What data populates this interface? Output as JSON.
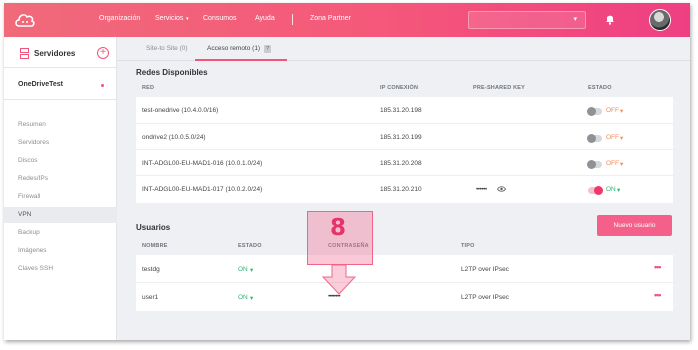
{
  "nav": {
    "items": [
      "Organización",
      "Servicios",
      "Consumos",
      "Ayuda",
      "Zona Partner"
    ],
    "services_caret": "▾",
    "select_caret": "▾"
  },
  "sidebar": {
    "title": "Servidores",
    "add": "+",
    "account": "OneDriveTest",
    "items": [
      "Resumen",
      "Servidores",
      "Discos",
      "Redes/IPs",
      "Firewall",
      "VPN",
      "Backup",
      "Imágenes",
      "Claves SSH"
    ],
    "active_item": "VPN"
  },
  "tabs": {
    "site_to_site": "Site-to Site (0)",
    "remote_access": "Acceso remoto (1)",
    "remote_badge": "?"
  },
  "networks": {
    "title": "Redes Disponibles",
    "headers": {
      "red": "RED",
      "ip": "IP CONEXIÓN",
      "psk": "PRE-SHARED KEY",
      "estado": "ESTADO"
    },
    "rows": [
      {
        "name": "test-onedrive (10.4.0.0/16)",
        "ip": "185.31.20.198",
        "psk": "",
        "status": "OFF",
        "on": false
      },
      {
        "name": "ondrive2 (10.0.5.0/24)",
        "ip": "185.31.20.199",
        "psk": "",
        "status": "OFF",
        "on": false
      },
      {
        "name": "INT-ADGL00-EU-MAD1-016 (10.0.1.0/24)",
        "ip": "185.31.20.208",
        "psk": "",
        "status": "OFF",
        "on": false
      },
      {
        "name": "INT-ADGL00-EU-MAD1-017 (10.0.2.0/24)",
        "ip": "185.31.20.210",
        "psk": "••••••",
        "status": "ON",
        "on": true
      }
    ]
  },
  "users": {
    "title": "Usuarios",
    "new_button": "Nuevo usuario",
    "headers": {
      "nombre": "NOMBRE",
      "estado": "ESTADO",
      "password": "CONTRASEÑA",
      "tipo": "TIPO"
    },
    "rows": [
      {
        "name": "testdg",
        "status": "ON",
        "password": "",
        "type": "L2TP over IPsec"
      },
      {
        "name": "user1",
        "status": "ON",
        "password": "••••••••",
        "type": "L2TP over IPsec"
      }
    ]
  },
  "annotation": {
    "step": "8"
  },
  "colors": {
    "brand": "#f2557a",
    "on": "#2bb673",
    "off": "#f58a5a"
  }
}
